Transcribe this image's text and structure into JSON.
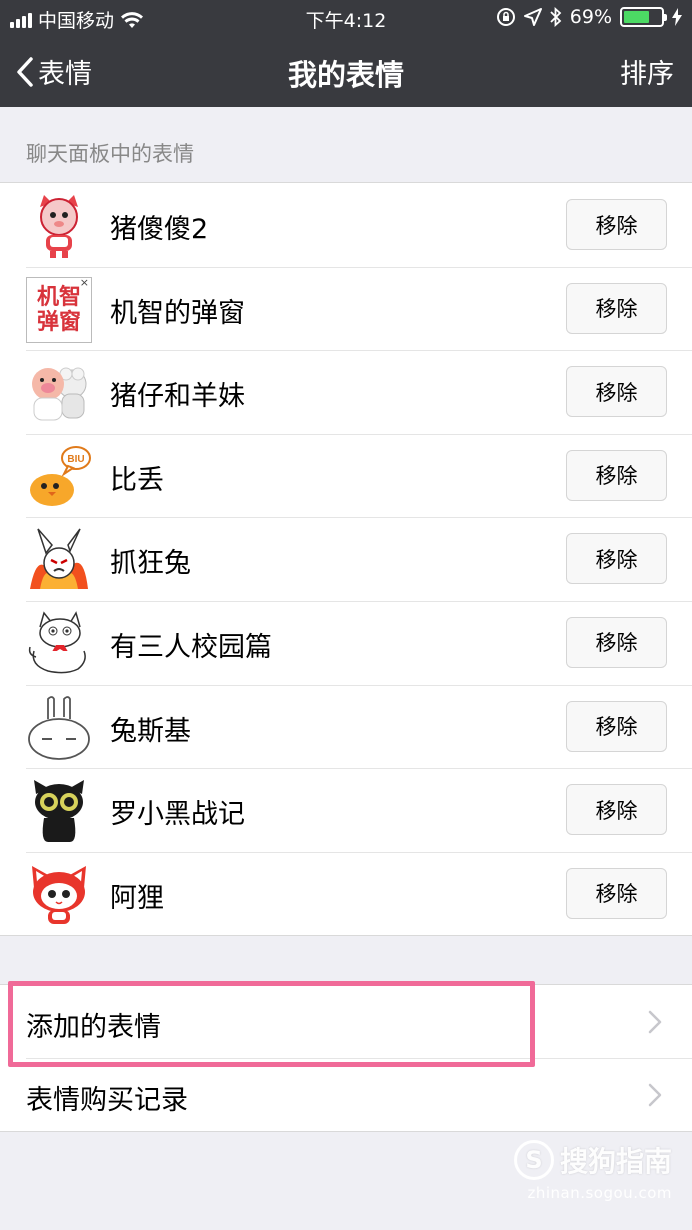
{
  "status_bar": {
    "carrier": "中国移动",
    "time": "下午4:12",
    "battery_percent": "69%",
    "battery_level": 0.69,
    "icons": [
      "signal-icon",
      "wifi-icon",
      "rotation-lock-icon",
      "location-icon",
      "bluetooth-icon",
      "battery-icon",
      "charging-icon"
    ]
  },
  "nav": {
    "back_label": "表情",
    "title": "我的表情",
    "sort_label": "排序"
  },
  "section_header": "聊天面板中的表情",
  "sticker_packs": [
    {
      "name": "猪傻傻2",
      "remove_label": "移除"
    },
    {
      "name": "机智的弹窗",
      "remove_label": "移除",
      "thumb_text": "机智弹窗"
    },
    {
      "name": "猪仔和羊妹",
      "remove_label": "移除"
    },
    {
      "name": "比丢",
      "remove_label": "移除",
      "thumb_text": "BIU"
    },
    {
      "name": "抓狂兔",
      "remove_label": "移除"
    },
    {
      "name": "有三人校园篇",
      "remove_label": "移除"
    },
    {
      "name": "兔斯基",
      "remove_label": "移除"
    },
    {
      "name": "罗小黑战记",
      "remove_label": "移除"
    },
    {
      "name": "阿狸",
      "remove_label": "移除"
    }
  ],
  "menu": [
    {
      "label": "添加的表情"
    },
    {
      "label": "表情购买记录"
    }
  ],
  "watermark": {
    "brand": "搜狗指南",
    "badge": "S",
    "url": "zhinan.sogou.com"
  },
  "colors": {
    "nav_bg": "#393a3f",
    "page_bg": "#efeff4",
    "highlight": "#f06a98",
    "battery": "#4cd964"
  }
}
